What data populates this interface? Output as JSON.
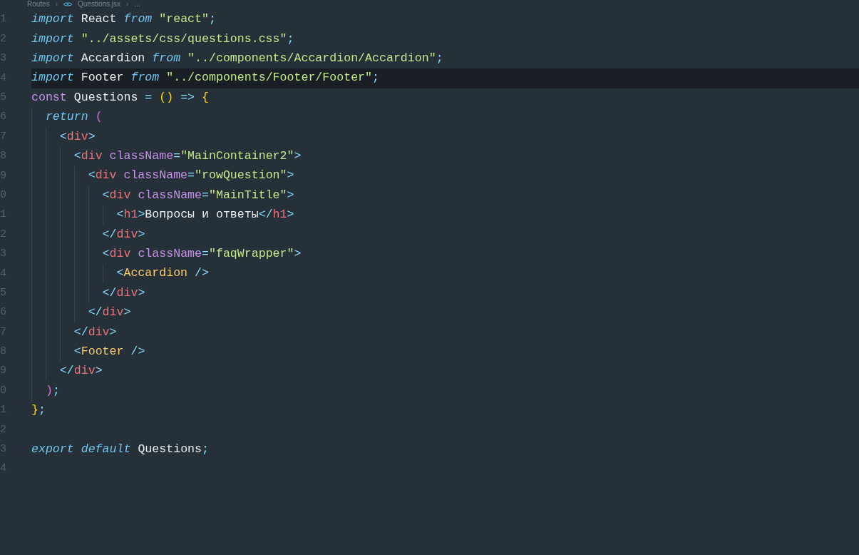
{
  "breadcrumb": [
    {
      "text": "Routes",
      "kind": "folder"
    },
    {
      "text": "›",
      "kind": "separator"
    },
    {
      "text": "Questions.jsx",
      "kind": "file"
    },
    {
      "text": "›",
      "kind": "separator"
    },
    {
      "text": "...",
      "kind": "more"
    }
  ],
  "editor": {
    "lines": [
      {
        "number": "1",
        "current": false,
        "tokens": [
          {
            "text": "import",
            "kind": "keyword"
          },
          {
            "text": " React ",
            "kind": "ident"
          },
          {
            "text": "from",
            "kind": "keyword"
          },
          {
            "text": " \"react\"",
            "kind": "string"
          },
          {
            "text": ";",
            "kind": "punct"
          }
        ]
      },
      {
        "number": "2",
        "current": false,
        "tokens": [
          {
            "text": "import",
            "kind": "keyword"
          },
          {
            "text": " \"../assets/css/questions.css\"",
            "kind": "string"
          },
          {
            "text": ";",
            "kind": "punct"
          }
        ]
      },
      {
        "number": "3",
        "current": false,
        "tokens": [
          {
            "text": "import",
            "kind": "keyword"
          },
          {
            "text": " Accardion ",
            "kind": "ident"
          },
          {
            "text": "from",
            "kind": "keyword"
          },
          {
            "text": " \"../components/Accardion/Accardion\"",
            "kind": "string"
          },
          {
            "text": ";",
            "kind": "punct"
          }
        ]
      },
      {
        "number": "4",
        "current": true,
        "tokens": [
          {
            "text": "import",
            "kind": "keyword"
          },
          {
            "text": " Footer ",
            "kind": "ident"
          },
          {
            "text": "from",
            "kind": "keyword"
          },
          {
            "text": " \"../components/Footer/Footer\"",
            "kind": "string"
          },
          {
            "text": ";",
            "kind": "punct"
          }
        ]
      },
      {
        "number": "5",
        "current": false,
        "tokens": [
          {
            "text": "const",
            "kind": "storage"
          },
          {
            "text": " Questions ",
            "kind": "ident"
          },
          {
            "text": "=",
            "kind": "punct"
          },
          {
            "text": " () ",
            "kind": "bracket"
          },
          {
            "text": "=>",
            "kind": "punct"
          },
          {
            "text": " {",
            "kind": "bracket"
          }
        ]
      },
      {
        "number": "6",
        "current": false,
        "tokens": [
          {
            "text": "  return",
            "kind": "keyword"
          },
          {
            "text": " (",
            "kind": "paren"
          }
        ]
      },
      {
        "number": "7",
        "current": false,
        "tokens": [
          {
            "text": "    <",
            "kind": "punct"
          },
          {
            "text": "div",
            "kind": "tag"
          },
          {
            "text": ">",
            "kind": "punct"
          }
        ]
      },
      {
        "number": "8",
        "current": false,
        "tokens": [
          {
            "text": "      <",
            "kind": "punct"
          },
          {
            "text": "div",
            "kind": "tag"
          },
          {
            "text": " className",
            "kind": "attr"
          },
          {
            "text": "=",
            "kind": "punct"
          },
          {
            "text": "\"MainContainer2\"",
            "kind": "string"
          },
          {
            "text": ">",
            "kind": "punct"
          }
        ]
      },
      {
        "number": "9",
        "current": false,
        "tokens": [
          {
            "text": "        <",
            "kind": "punct"
          },
          {
            "text": "div",
            "kind": "tag"
          },
          {
            "text": " className",
            "kind": "attr"
          },
          {
            "text": "=",
            "kind": "punct"
          },
          {
            "text": "\"rowQuestion\"",
            "kind": "string"
          },
          {
            "text": ">",
            "kind": "punct"
          }
        ]
      },
      {
        "number": "0",
        "current": false,
        "tokens": [
          {
            "text": "          <",
            "kind": "punct"
          },
          {
            "text": "div",
            "kind": "tag"
          },
          {
            "text": " className",
            "kind": "attr"
          },
          {
            "text": "=",
            "kind": "punct"
          },
          {
            "text": "\"MainTitle\"",
            "kind": "string"
          },
          {
            "text": ">",
            "kind": "punct"
          }
        ]
      },
      {
        "number": "1",
        "current": false,
        "tokens": [
          {
            "text": "            <",
            "kind": "punct"
          },
          {
            "text": "h1",
            "kind": "tag"
          },
          {
            "text": ">",
            "kind": "punct"
          },
          {
            "text": "Вопросы и ответы",
            "kind": "ident"
          },
          {
            "text": "</",
            "kind": "punct"
          },
          {
            "text": "h1",
            "kind": "tag"
          },
          {
            "text": ">",
            "kind": "punct"
          }
        ]
      },
      {
        "number": "2",
        "current": false,
        "tokens": [
          {
            "text": "          </",
            "kind": "punct"
          },
          {
            "text": "div",
            "kind": "tag"
          },
          {
            "text": ">",
            "kind": "punct"
          }
        ]
      },
      {
        "number": "3",
        "current": false,
        "tokens": [
          {
            "text": "          <",
            "kind": "punct"
          },
          {
            "text": "div",
            "kind": "tag"
          },
          {
            "text": " className",
            "kind": "attr"
          },
          {
            "text": "=",
            "kind": "punct"
          },
          {
            "text": "\"faqWrapper\"",
            "kind": "string"
          },
          {
            "text": ">",
            "kind": "punct"
          }
        ]
      },
      {
        "number": "4",
        "current": false,
        "tokens": [
          {
            "text": "            <",
            "kind": "punct"
          },
          {
            "text": "Accardion",
            "kind": "component"
          },
          {
            "text": " />",
            "kind": "punct"
          }
        ]
      },
      {
        "number": "5",
        "current": false,
        "tokens": [
          {
            "text": "          </",
            "kind": "punct"
          },
          {
            "text": "div",
            "kind": "tag"
          },
          {
            "text": ">",
            "kind": "punct"
          }
        ]
      },
      {
        "number": "6",
        "current": false,
        "tokens": [
          {
            "text": "        </",
            "kind": "punct"
          },
          {
            "text": "div",
            "kind": "tag"
          },
          {
            "text": ">",
            "kind": "punct"
          }
        ]
      },
      {
        "number": "7",
        "current": false,
        "tokens": [
          {
            "text": "      </",
            "kind": "punct"
          },
          {
            "text": "div",
            "kind": "tag"
          },
          {
            "text": ">",
            "kind": "punct"
          }
        ]
      },
      {
        "number": "8",
        "current": false,
        "tokens": [
          {
            "text": "      <",
            "kind": "punct"
          },
          {
            "text": "Footer",
            "kind": "component"
          },
          {
            "text": " />",
            "kind": "punct"
          }
        ]
      },
      {
        "number": "9",
        "current": false,
        "tokens": [
          {
            "text": "    </",
            "kind": "punct"
          },
          {
            "text": "div",
            "kind": "tag"
          },
          {
            "text": ">",
            "kind": "punct"
          }
        ]
      },
      {
        "number": "0",
        "current": false,
        "tokens": [
          {
            "text": "  )",
            "kind": "paren"
          },
          {
            "text": ";",
            "kind": "punct"
          }
        ]
      },
      {
        "number": "1",
        "current": false,
        "tokens": [
          {
            "text": "}",
            "kind": "bracket"
          },
          {
            "text": ";",
            "kind": "punct"
          }
        ]
      },
      {
        "number": "2",
        "current": false
      },
      {
        "number": "3",
        "current": false,
        "tokens": [
          {
            "text": "export",
            "kind": "keyword"
          },
          {
            "text": " default",
            "kind": "keyword"
          },
          {
            "text": " Questions",
            "kind": "ident"
          },
          {
            "text": ";",
            "kind": "punct"
          }
        ]
      },
      {
        "number": "4",
        "current": false
      }
    ]
  }
}
